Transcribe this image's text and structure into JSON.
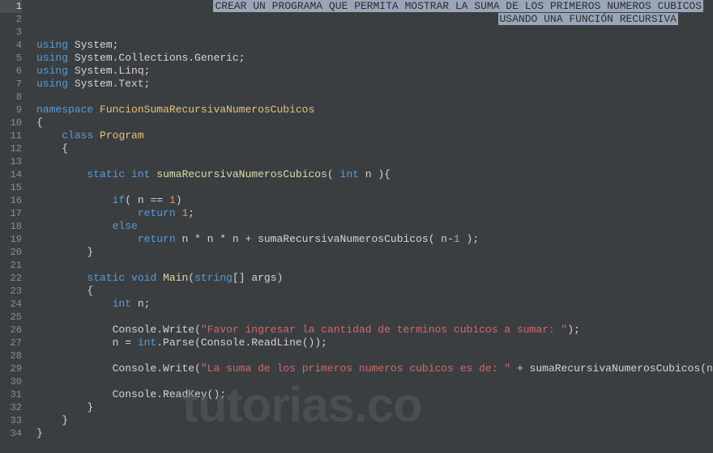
{
  "lineCount": 34,
  "activeLine": 1,
  "selection": {
    "line1": "CREAR UN PROGRAMA QUE PERMITA MOSTRAR LA SUMA DE LOS PRIMEROS NUMEROS CUBICOS",
    "line2": "USANDO UNA FUNCIÓN RECURSIVA"
  },
  "code": {
    "using": "using",
    "namespace_kw": "namespace",
    "class_kw": "class",
    "static_kw": "static",
    "int_kw": "int",
    "void_kw": "void",
    "if_kw": "if",
    "else_kw": "else",
    "return_kw": "return",
    "system": "System",
    "collections": "System.Collections.Generic",
    "linq": "System.Linq",
    "text": "System.Text",
    "namespace_name": "FuncionSumaRecursivaNumerosCubicos",
    "class_name": "Program",
    "func_name": "sumaRecursivaNumerosCubicos",
    "main_name": "Main",
    "string_arr": "string",
    "args": "args",
    "param_n": "n",
    "num1": "1",
    "console": "Console",
    "write": "Write",
    "parse": "Parse",
    "readline": "ReadLine",
    "readkey": "ReadKey",
    "str1": "\"Favor ingresar la cantidad de terminos cubicos a sumar: \"",
    "str2": "\"La suma de los primeros numeros cubicos es de: \""
  },
  "watermark": "tutorias.co"
}
